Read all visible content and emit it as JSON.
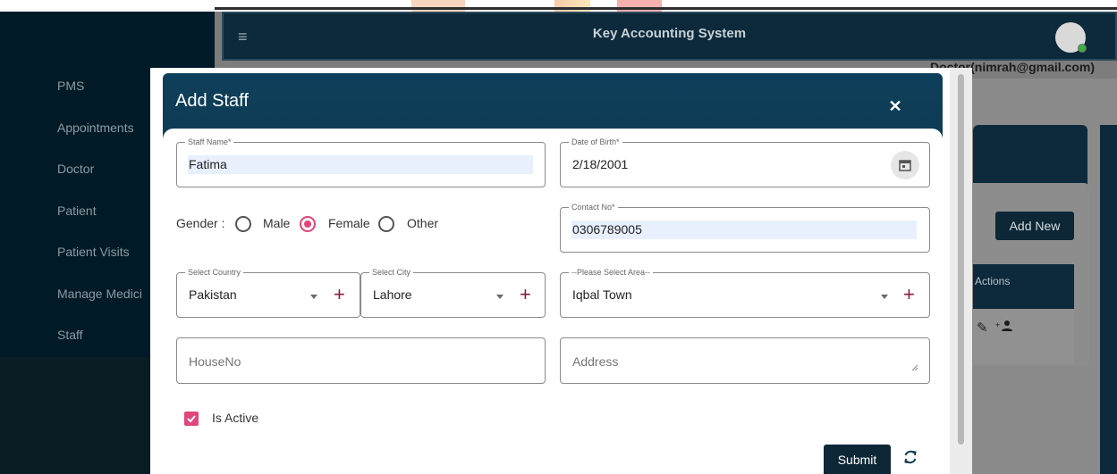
{
  "app": {
    "title": "Key Accounting System",
    "user_label": "Doctor(nimrah@gmail.com)",
    "hamburger_glyph": "≡"
  },
  "sidebar": {
    "items": [
      {
        "label": "PMS"
      },
      {
        "label": "Appointments"
      },
      {
        "label": "Doctor"
      },
      {
        "label": "Patient"
      },
      {
        "label": "Patient Visits"
      },
      {
        "label": "Manage Medici"
      },
      {
        "label": "Staff"
      }
    ]
  },
  "page": {
    "add_new_label": "Add New",
    "actions_header": "Actions",
    "action_icons": [
      "edit-icon",
      "add-person-icon"
    ]
  },
  "dialog": {
    "title": "Add Staff",
    "close_glyph": "✕",
    "staff_name": {
      "label": "Staff Name*",
      "value": "Fatima"
    },
    "dob": {
      "label": "Date of Birth*",
      "value": "2/18/2001"
    },
    "gender": {
      "label": "Gender :",
      "options": [
        "Male",
        "Female",
        "Other"
      ],
      "selected": "Female"
    },
    "contact": {
      "label": "Contact No*",
      "value": "0306789005"
    },
    "country": {
      "label": "Select Country",
      "value": "Pakistan"
    },
    "city": {
      "label": "Select City",
      "value": "Lahore"
    },
    "area": {
      "label": "--Please Select Area--",
      "value": "Iqbal Town"
    },
    "house_no": {
      "placeholder": "HouseNo"
    },
    "address": {
      "placeholder": "Address"
    },
    "is_active": {
      "label": "Is Active",
      "checked": true
    },
    "submit_label": "Submit",
    "plus_glyph": "+"
  },
  "colors": {
    "accent_pink": "#e0457b",
    "dialog_header": "#0c3147",
    "button_dark": "#0d2736",
    "plus_red": "#8b1a3a"
  }
}
